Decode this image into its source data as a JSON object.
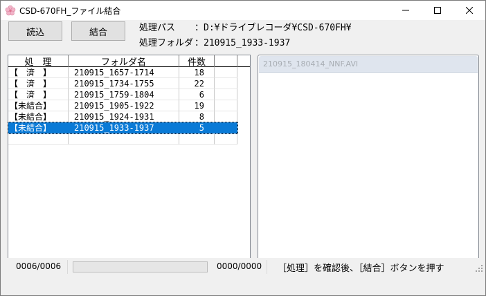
{
  "window": {
    "title": "CSD-670FH_ファイル結合",
    "icon": "sakura-flower-icon",
    "controls": {
      "minimize": "minimize-icon",
      "maximize": "maximize-icon",
      "close": "close-icon"
    }
  },
  "toolbar": {
    "load_label": "読込",
    "merge_label": "結合"
  },
  "info": {
    "path_label": "処理パス",
    "path_value": "：D:¥ドライブレコーダ¥CSD-670FH¥",
    "folder_label": "処理フォルダ",
    "folder_value": "：210915_1933-1937"
  },
  "list": {
    "columns": [
      "処　理",
      "フォルダ名",
      "件数",
      ""
    ],
    "rows": [
      {
        "status": "【　済　】",
        "folder": "210915_1657-1714",
        "count": "18"
      },
      {
        "status": "【　済　】",
        "folder": "210915_1734-1755",
        "count": "22"
      },
      {
        "status": "【　済　】",
        "folder": "210915_1759-1804",
        "count": "6"
      },
      {
        "status": "【未結合】",
        "folder": "210915_1905-1922",
        "count": "19"
      },
      {
        "status": "【未結合】",
        "folder": "210915_1924-1931",
        "count": "8"
      },
      {
        "status": "【未結合】",
        "folder": "210915_1933-1937",
        "count": "5"
      }
    ],
    "selected_index": 5,
    "selection_color": "#0a7ad6"
  },
  "file_panel": {
    "header": "210915_180414_NNF.AVI"
  },
  "statusbar": {
    "position": "0006/0006",
    "progress": 0,
    "count": "0000/0000",
    "message": "［処理］を確認後、［結合］ボタンを押す"
  }
}
